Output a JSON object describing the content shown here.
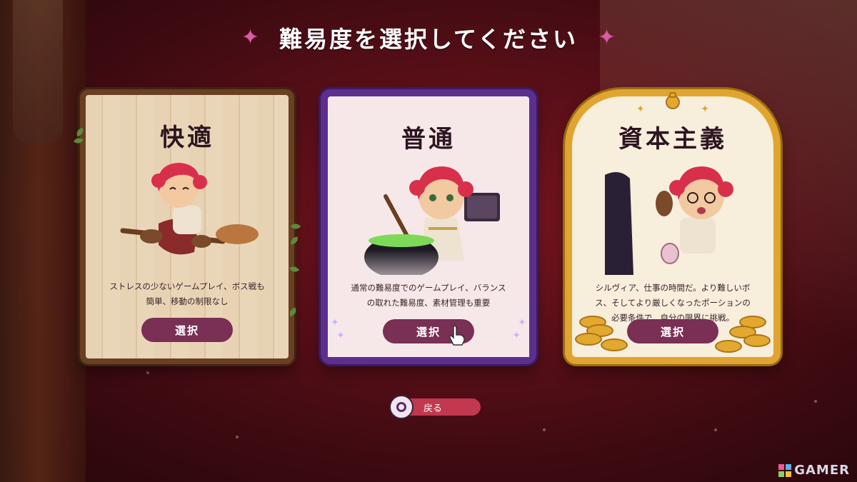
{
  "screen": {
    "title": "難易度を選択してください",
    "title_star_icon": "✦"
  },
  "difficulties": [
    {
      "name": "快適",
      "description": "ストレスの少ないゲームプレイ、ボス戦も簡単、移動の制限なし",
      "select_label": "選択"
    },
    {
      "name": "普通",
      "description": "通常の難易度でのゲームプレイ、バランスの取れた難易度、素材管理も重要",
      "select_label": "選択"
    },
    {
      "name": "資本主義",
      "description": "シルヴィア、仕事の時間だ。より難しいボス、そしてより厳しくなったポーションの必要条件で、自分の限界に挑戦。",
      "select_label": "選択"
    }
  ],
  "back": {
    "label": "戻る",
    "icon": "circle-button-icon"
  },
  "watermark": {
    "text": "GAMER"
  },
  "colors": {
    "background": "#5a0f18",
    "select_button": "#7a2f55",
    "back_button": "#c2384e",
    "title_star": "#d85aa8",
    "purple_frame": "#5c2f8e",
    "gold_frame": "#e0a530",
    "wood_frame": "#6a3f22"
  }
}
